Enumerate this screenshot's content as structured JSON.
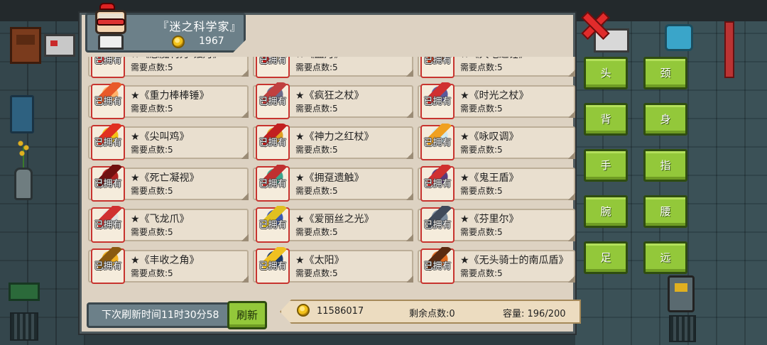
{
  "profile": {
    "name": "『迷之科学家』",
    "coins": "1967"
  },
  "item_labels": {
    "owned": "已拥有",
    "cost": "需要点数:5"
  },
  "items": [
    {
      "name": "★《恶魔利刃-蚀月》",
      "art_color": "#d8c8a0",
      "art_accent": "#e33"
    },
    {
      "name": "★《血月》",
      "art_color": "#d8c8a0",
      "art_accent": "#c22"
    },
    {
      "name": "★《大地之锤》",
      "art_color": "#8c5a3c",
      "art_accent": "#d04020"
    },
    {
      "name": "★《重力棒棒锤》",
      "art_color": "#ffb36b",
      "art_accent": "#e85a2a"
    },
    {
      "name": "★《疯狂之杖》",
      "art_color": "#6b6b8c",
      "art_accent": "#c04040"
    },
    {
      "name": "★《时光之杖》",
      "art_color": "#5a5a9c",
      "art_accent": "#d03030"
    },
    {
      "name": "★《尖叫鸡》",
      "art_color": "#f2c21a",
      "art_accent": "#e03020"
    },
    {
      "name": "★《神力之红杖》",
      "art_color": "#e0a020",
      "art_accent": "#c22020"
    },
    {
      "name": "★《咏叹调》",
      "art_color": "#cfe8f0",
      "art_accent": "#f0a020"
    },
    {
      "name": "★《死亡凝视》",
      "art_color": "#b02020",
      "art_accent": "#701010"
    },
    {
      "name": "★《拥趸遗触》",
      "art_color": "#3aa58c",
      "art_accent": "#c03030"
    },
    {
      "name": "★《鬼王盾》",
      "art_color": "#5a3a7a",
      "art_accent": "#d03030"
    },
    {
      "name": "★《飞龙爪》",
      "art_color": "#e0e0e0",
      "art_accent": "#d03030"
    },
    {
      "name": "★《爱丽丝之光》",
      "art_color": "#3a5ab0",
      "art_accent": "#e0c020"
    },
    {
      "name": "★《芬里尔》",
      "art_color": "#7a8a9c",
      "art_accent": "#404a5a"
    },
    {
      "name": "★《丰收之角》",
      "art_color": "#f0b020",
      "art_accent": "#8a5a10"
    },
    {
      "name": "★《太阳》",
      "art_color": "#1c3a6a",
      "art_accent": "#f0c020"
    },
    {
      "name": "★《无头骑士的南瓜盾》",
      "art_color": "#e06a20",
      "art_accent": "#5a2a10"
    }
  ],
  "bottom": {
    "refresh_time": "下次刷新时间11时30分58",
    "refresh_button": "刷新",
    "coins": "11586017",
    "points": "剩余点数:0",
    "capacity": "容量: 196/200"
  },
  "slots": [
    {
      "label": "头"
    },
    {
      "label": "颈"
    },
    {
      "label": "背"
    },
    {
      "label": "身"
    },
    {
      "label": "手"
    },
    {
      "label": "指"
    },
    {
      "label": "腕"
    },
    {
      "label": "腰"
    },
    {
      "label": "足"
    },
    {
      "label": "远"
    }
  ],
  "colors": {
    "panel_bg": "#ddd2c2",
    "button_green": "#93c83a",
    "owned_frame": "#c7342f",
    "close_red": "#e12b2b"
  }
}
